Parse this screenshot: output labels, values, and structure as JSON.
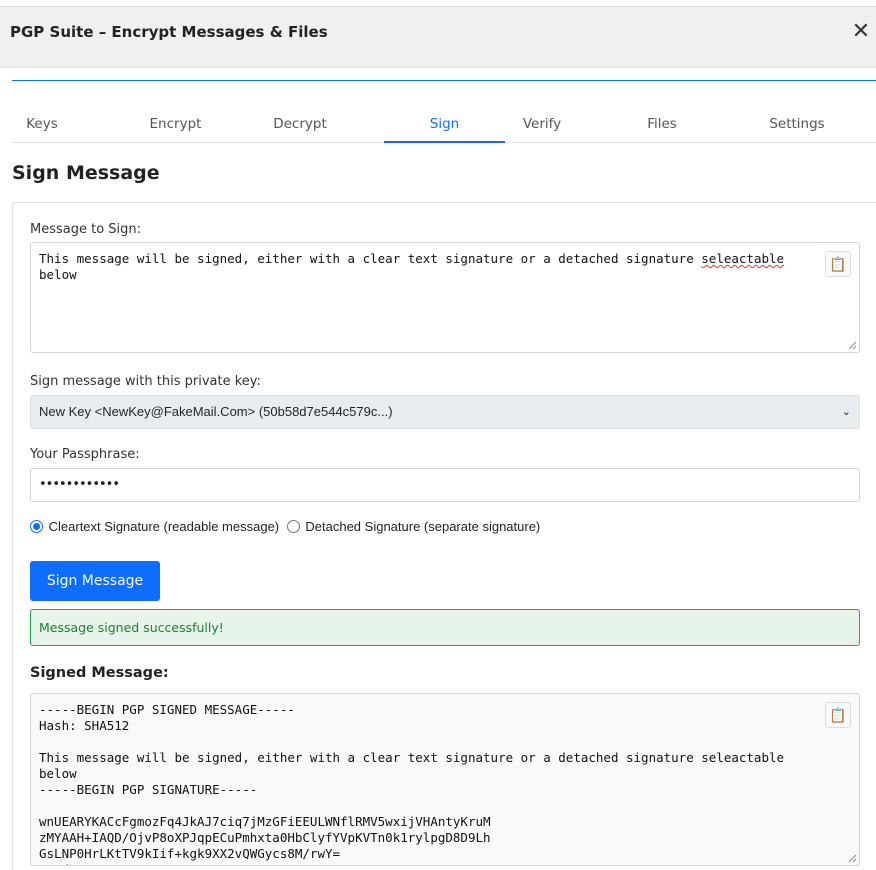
{
  "window": {
    "title": "PGP Suite – Encrypt Messages & Files",
    "close_glyph": "✕"
  },
  "tabs": [
    {
      "label": "Keys"
    },
    {
      "label": "Encrypt"
    },
    {
      "label": "Decrypt"
    },
    {
      "label": "Sign",
      "active": true
    },
    {
      "label": "Verify"
    },
    {
      "label": "Files"
    },
    {
      "label": "Settings"
    }
  ],
  "page": {
    "title": "Sign Message"
  },
  "form": {
    "message_label": "Message to Sign:",
    "message_value_before": "This message will be signed, either with a clear text signature or a detached signature ",
    "message_value_misspelled": "seleactable",
    "message_value_after": "\nbelow",
    "copy_icon": "📋",
    "key_label": "Sign message with this private key:",
    "key_selected": "New Key <NewKey@FakeMail.Com> (50b58d7e544c579c...)",
    "key_chevron": "⌄",
    "passphrase_label": "Your Passphrase:",
    "passphrase_masked": "••••••••••••",
    "radio_cleartext": "Cleartext Signature (readable message)",
    "radio_detached": "Detached Signature (separate signature)",
    "selected_mode": "cleartext",
    "sign_button": "Sign Message",
    "success_message": "Message signed successfully!",
    "output_label": "Signed Message:",
    "output_value": "-----BEGIN PGP SIGNED MESSAGE-----\nHash: SHA512\n\nThis message will be signed, either with a clear text signature or a detached signature seleactable\nbelow\n-----BEGIN PGP SIGNATURE-----\n\nwnUEARYKACcFgmozFq4JkAJ7ciq7jMzGFiEEULWNflRMV5wxijVHAntyKruM\nzMYAAH+IAQD/OjvP8oXPJqpECuPmhxta0HbClyfYVpKVTn0k1rylpgD8D9Lh\nGsLNP0HrLKtTV9kIif+kgk9XX2vQWGycs8M/rwY=\n=MydW"
  },
  "colors": {
    "accent": "#0d6efd",
    "success_text": "#1e7e34",
    "success_bg": "#e6f4ea",
    "success_border": "#28a745"
  }
}
